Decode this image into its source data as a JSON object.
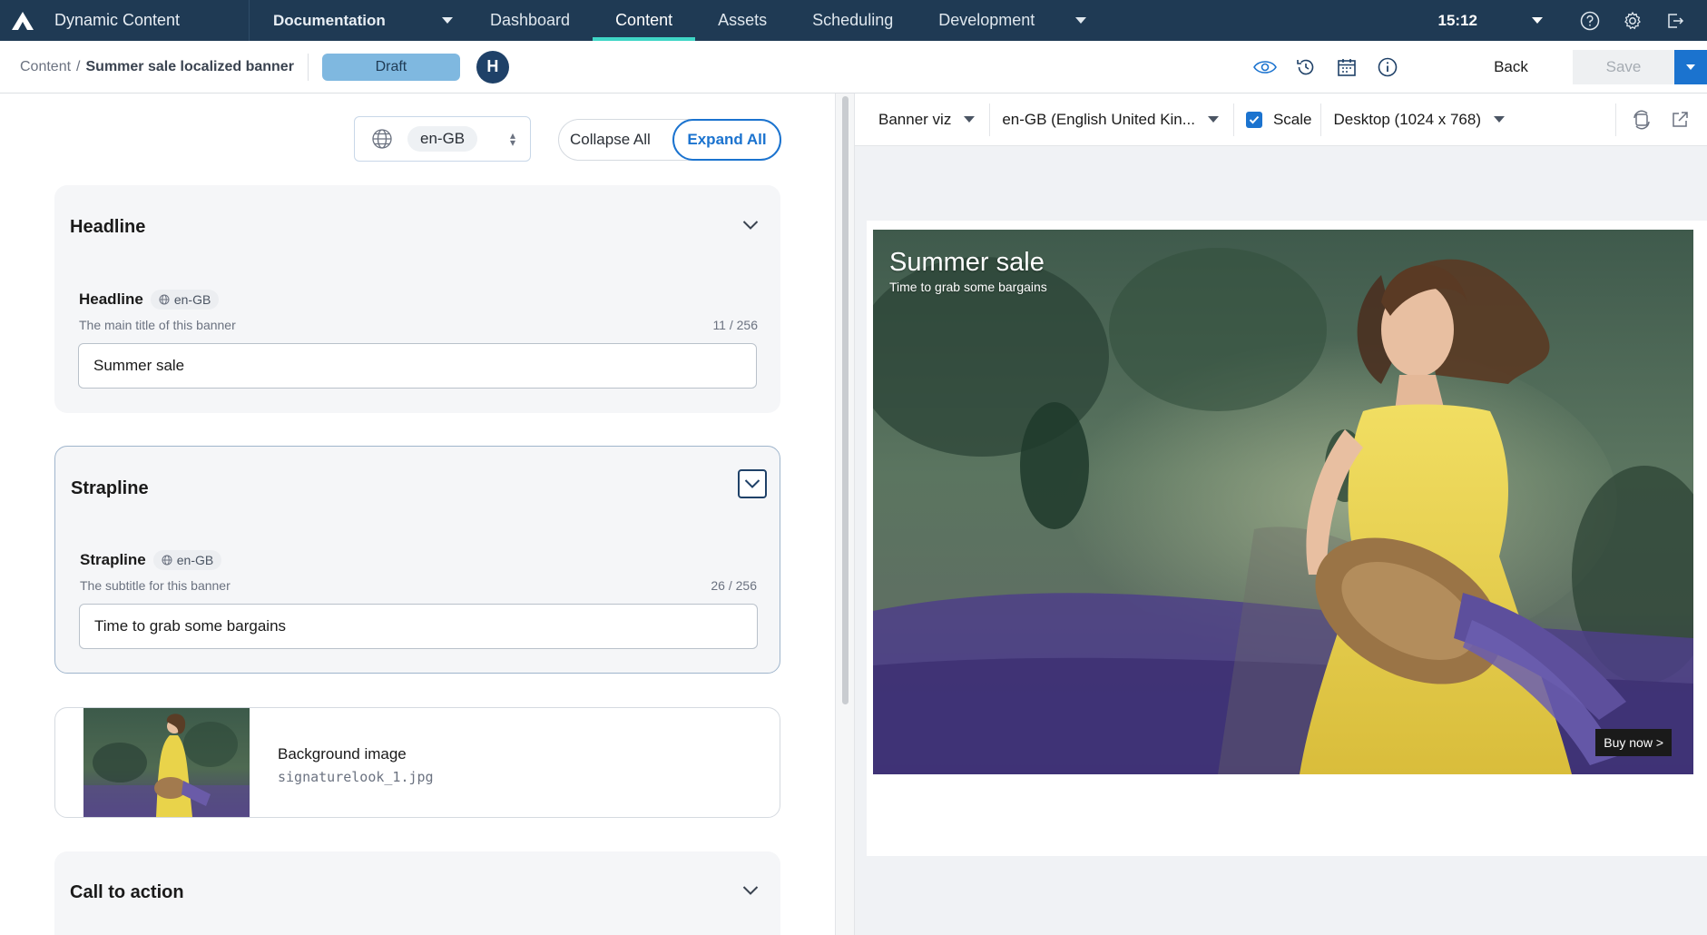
{
  "app": {
    "name": "Dynamic Content"
  },
  "topnav": {
    "hub_menu": "Documentation",
    "tabs": [
      {
        "label": "Dashboard"
      },
      {
        "label": "Content"
      },
      {
        "label": "Assets"
      },
      {
        "label": "Scheduling"
      },
      {
        "label": "Development"
      }
    ],
    "active_tab": "Content",
    "clock": "15:12",
    "icons": [
      "help-icon",
      "gear-icon",
      "logout-icon"
    ]
  },
  "subbar": {
    "breadcrumb_root": "Content",
    "breadcrumb_sep": "/",
    "breadcrumb_current": "Summer sale localized banner",
    "status": "Draft",
    "avatar_initial": "H",
    "icons": [
      "eye-icon",
      "history-icon",
      "calendar-icon",
      "info-icon"
    ],
    "back_label": "Back",
    "save_label": "Save"
  },
  "editor": {
    "locale": "en-GB",
    "collapse_all": "Collapse All",
    "expand_all": "Expand All",
    "sections": {
      "headline": {
        "title": "Headline",
        "field_label": "Headline",
        "field_locale": "en-GB",
        "help": "The main title of this banner",
        "count": "11 / 256",
        "value": "Summer sale"
      },
      "strapline": {
        "title": "Strapline",
        "field_label": "Strapline",
        "field_locale": "en-GB",
        "help": "The subtitle for this banner",
        "count": "26 / 256",
        "value": "Time to grab some bargains"
      },
      "background_image": {
        "title": "Background image",
        "filename": "signaturelook_1.jpg"
      },
      "cta": {
        "title": "Call to action"
      }
    }
  },
  "preview": {
    "visualization": "Banner viz",
    "locale": "en-GB (English United Kin...",
    "scale_label": "Scale",
    "scale_checked": true,
    "device": "Desktop (1024 x 768)",
    "banner": {
      "title": "Summer sale",
      "subtitle": "Time to grab some bargains",
      "cta": "Buy now >"
    }
  },
  "colors": {
    "nav_bg": "#1f3a54",
    "accent": "#1b73cf",
    "active_tab_underline": "#3fd6c6",
    "draft_pill": "#7fb8e0",
    "avatar": "#1f4168"
  }
}
